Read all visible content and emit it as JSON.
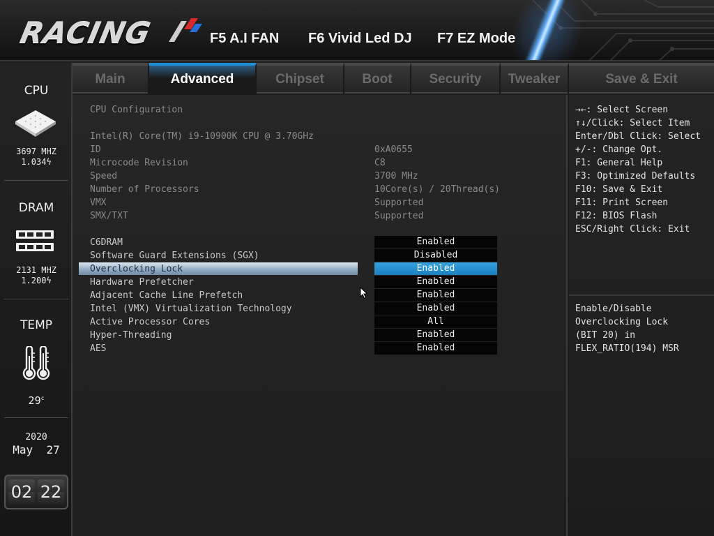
{
  "header": {
    "logo_text": "RACING",
    "hotkeys": [
      "F5 A.I FAN",
      "F6 Vivid Led DJ",
      "F7 EZ Mode"
    ]
  },
  "tabs": [
    {
      "label": "Main",
      "active": false
    },
    {
      "label": "Advanced",
      "active": true
    },
    {
      "label": "Chipset",
      "active": false
    },
    {
      "label": "Boot",
      "active": false
    },
    {
      "label": "Security",
      "active": false
    },
    {
      "label": "Tweaker",
      "active": false
    },
    {
      "label": "Save & Exit",
      "active": false
    }
  ],
  "sidebar": {
    "cpu": {
      "label": "CPU",
      "freq": "3697 MHZ",
      "volt": "1.034"
    },
    "dram": {
      "label": "DRAM",
      "freq": "2131 MHZ",
      "volt": "1.200"
    },
    "temp": {
      "label": "TEMP",
      "value": "29",
      "unit": "c"
    },
    "date": {
      "year": "2020",
      "month_day": "May  27"
    },
    "clock": {
      "hours": "02",
      "minutes": "22"
    },
    "icons": [
      "cpu-chip-icon",
      "ram-module-icon",
      "thermometer-icon",
      "bolt-icon"
    ]
  },
  "main": {
    "section_title": "CPU Configuration",
    "cpu_name": "Intel(R) Core(TM) i9-10900K CPU @ 3.70GHz",
    "info": [
      {
        "label": "ID",
        "value": "0xA0655"
      },
      {
        "label": "Microcode Revision",
        "value": "C8"
      },
      {
        "label": "Speed",
        "value": "3700 MHz"
      },
      {
        "label": "Number of Processors",
        "value": "10Core(s) / 20Thread(s)"
      },
      {
        "label": "VMX",
        "value": "Supported"
      },
      {
        "label": "SMX/TXT",
        "value": "Supported"
      }
    ],
    "settings": [
      {
        "label": "C6DRAM",
        "value": "Enabled",
        "selected": false
      },
      {
        "label": "Software Guard Extensions (SGX)",
        "value": "Disabled",
        "selected": false
      },
      {
        "label": "Overclocking Lock",
        "value": "Enabled",
        "selected": true
      },
      {
        "label": "Hardware Prefetcher",
        "value": "Enabled",
        "selected": false
      },
      {
        "label": "Adjacent Cache Line Prefetch",
        "value": "Enabled",
        "selected": false
      },
      {
        "label": "Intel (VMX) Virtualization Technology",
        "value": "Enabled",
        "selected": false
      },
      {
        "label": "Active Processor Cores",
        "value": "All",
        "selected": false
      },
      {
        "label": "Hyper-Threading",
        "value": "Enabled",
        "selected": false
      },
      {
        "label": "AES",
        "value": "Enabled",
        "selected": false
      }
    ]
  },
  "help": {
    "keys": [
      "→←: Select Screen",
      "↑↓/Click: Select Item",
      "Enter/Dbl Click: Select",
      "+/-: Change Opt.",
      "F1: General Help",
      "F3: Optimized Defaults",
      "F10: Save & Exit",
      "F11: Print Screen",
      "F12: BIOS Flash",
      "ESC/Right Click: Exit"
    ],
    "description": [
      "Enable/Disable",
      "Overclocking Lock",
      "(BIT 20) in",
      "FLEX_RATIO(194) MSR"
    ]
  },
  "colors": {
    "accent": "#1f8fd8",
    "selected_option": "#2a93d2",
    "background": "#1e1e1e"
  }
}
